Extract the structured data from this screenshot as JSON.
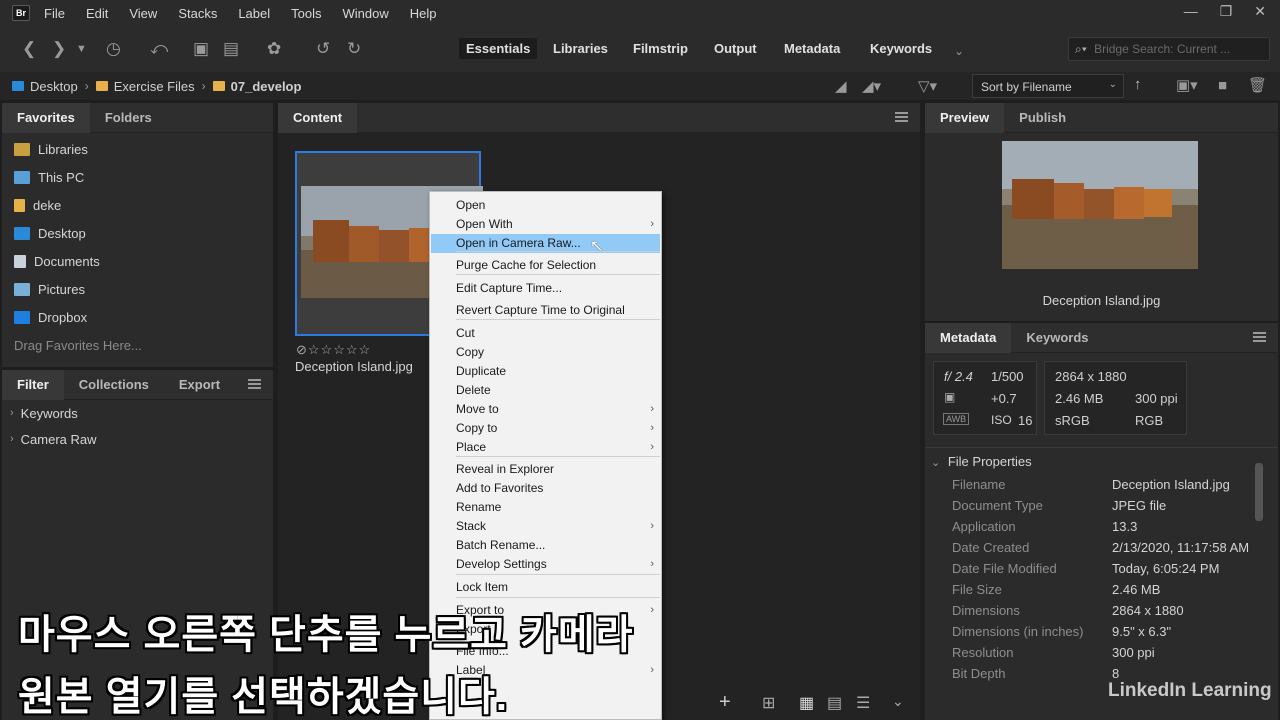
{
  "app": {
    "logo": "Br"
  },
  "menubar": [
    "File",
    "Edit",
    "View",
    "Stacks",
    "Label",
    "Tools",
    "Window",
    "Help"
  ],
  "workspaces": [
    "Essentials",
    "Libraries",
    "Filmstrip",
    "Output",
    "Metadata",
    "Keywords"
  ],
  "search": {
    "placeholder": "Bridge Search: Current ..."
  },
  "path": [
    "Desktop",
    "Exercise Files",
    "07_develop"
  ],
  "sort": {
    "label": "Sort by Filename"
  },
  "favorites": {
    "tabs": [
      "Favorites",
      "Folders"
    ],
    "items": [
      "Libraries",
      "This PC",
      "deke",
      "Desktop",
      "Documents",
      "Pictures",
      "Dropbox"
    ],
    "drag_hint": "Drag Favorites Here..."
  },
  "filter": {
    "tabs": [
      "Filter",
      "Collections",
      "Export"
    ],
    "items": [
      "Keywords",
      "Camera Raw"
    ]
  },
  "content": {
    "tab": "Content",
    "thumb_name": "Deception Island.jpg",
    "rating_stars": 0
  },
  "context_menu": [
    {
      "label": "Open",
      "arrow": false
    },
    {
      "label": "Open With",
      "arrow": true
    },
    {
      "label": "Open in Camera Raw...",
      "arrow": false,
      "highlighted": true
    },
    {
      "label": "Purge Cache for Selection",
      "arrow": false
    },
    {
      "label": "Edit Capture Time...",
      "arrow": false
    },
    {
      "label": "Revert Capture Time to Original",
      "arrow": false
    },
    {
      "label": "Cut",
      "arrow": false
    },
    {
      "label": "Copy",
      "arrow": false
    },
    {
      "label": "Duplicate",
      "arrow": false
    },
    {
      "label": "Delete",
      "arrow": false
    },
    {
      "label": "Move to",
      "arrow": true
    },
    {
      "label": "Copy to",
      "arrow": true
    },
    {
      "label": "Place",
      "arrow": true
    },
    {
      "label": "Reveal in Explorer",
      "arrow": false
    },
    {
      "label": "Add to Favorites",
      "arrow": false
    },
    {
      "label": "Rename",
      "arrow": false
    },
    {
      "label": "Stack",
      "arrow": true
    },
    {
      "label": "Batch Rename...",
      "arrow": false
    },
    {
      "label": "Develop Settings",
      "arrow": true
    },
    {
      "label": "Lock Item",
      "arrow": false
    },
    {
      "label": "Export to",
      "arrow": true
    },
    {
      "label": "Export",
      "arrow": false
    },
    {
      "label": "File Info...",
      "arrow": false
    },
    {
      "label": "Label",
      "arrow": true
    }
  ],
  "preview": {
    "tabs": [
      "Preview",
      "Publish"
    ],
    "filename": "Deception Island.jpg"
  },
  "metadata": {
    "tabs": [
      "Metadata",
      "Keywords"
    ],
    "aperture": "f/ 2.4",
    "shutter": "1/500",
    "exposure": "+0.7",
    "iso_label": "ISO",
    "iso": "16",
    "dims": "2864 x 1880",
    "size": "2.46 MB",
    "ppi": "300 ppi",
    "colorspace": "sRGB",
    "mode": "RGB",
    "section": "File Properties",
    "rows": [
      {
        "label": "Filename",
        "value": "Deception Island.jpg"
      },
      {
        "label": "Document Type",
        "value": "JPEG file"
      },
      {
        "label": "Application",
        "value": "13.3"
      },
      {
        "label": "Date Created",
        "value": "2/13/2020, 11:17:58 AM"
      },
      {
        "label": "Date File Modified",
        "value": "Today, 6:05:24 PM"
      },
      {
        "label": "File Size",
        "value": "2.46 MB"
      },
      {
        "label": "Dimensions",
        "value": "2864 x 1880"
      },
      {
        "label": "Dimensions (in inches)",
        "value": "9.5\" x 6.3\""
      },
      {
        "label": "Resolution",
        "value": "300 ppi"
      },
      {
        "label": "Bit Depth",
        "value": "8"
      }
    ]
  },
  "subtitles": [
    "마우스 오른쪽 단추를 누르고 카메라",
    "원본 열기를 선택하겠습니다."
  ],
  "watermark": "LinkedIn Learning"
}
